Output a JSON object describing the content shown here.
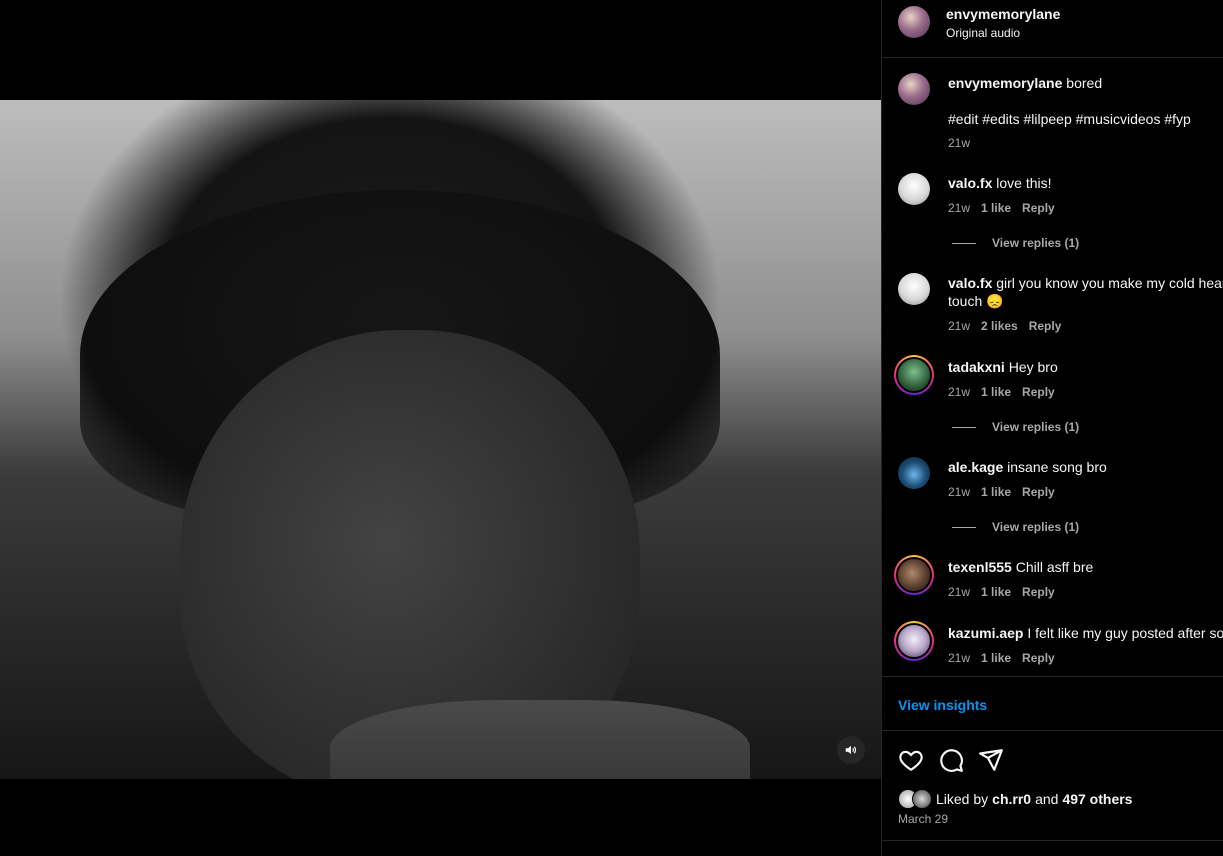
{
  "post": {
    "username": "envymemorylane",
    "audio": "Original audio",
    "caption_user": "envymemorylane",
    "caption_text": "bored",
    "hashtags": "#edit #edits #lilpeep #musicvideos #fyp",
    "caption_time": "21w"
  },
  "comments": [
    {
      "user": "valo.fx",
      "text": "love this!",
      "time": "21w",
      "likes": "1 like",
      "reply": "Reply",
      "view_replies": "View replies (1)"
    },
    {
      "user": "valo.fx",
      "text": "girl you know you make my cold heart",
      "text2": "touch 😞",
      "time": "21w",
      "likes": "2 likes",
      "reply": "Reply"
    },
    {
      "user": "tadakxni",
      "text": "Hey bro",
      "time": "21w",
      "likes": "1 like",
      "reply": "Reply",
      "view_replies": "View replies (1)"
    },
    {
      "user": "ale.kage",
      "text": "insane song bro",
      "time": "21w",
      "likes": "1 like",
      "reply": "Reply",
      "view_replies": "View replies (1)"
    },
    {
      "user": "texenl555",
      "text": "Chill asff bre",
      "time": "21w",
      "likes": "1 like",
      "reply": "Reply"
    },
    {
      "user": "kazumi.aep",
      "text": "I felt like my guy posted after so",
      "time": "21w",
      "likes": "1 like",
      "reply": "Reply"
    }
  ],
  "footer": {
    "insights": "View insights",
    "liked_prefix": "Liked by",
    "liked_user": "ch.rr0",
    "liked_and": "and",
    "liked_others": "497 others",
    "date": "March 29"
  },
  "icons": {
    "like": "heart-icon",
    "comment": "comment-icon",
    "share": "send-icon",
    "volume": "speaker-icon"
  },
  "colors": {
    "accent": "#0095f6",
    "muted": "#a8a8a8",
    "background": "#000000"
  }
}
